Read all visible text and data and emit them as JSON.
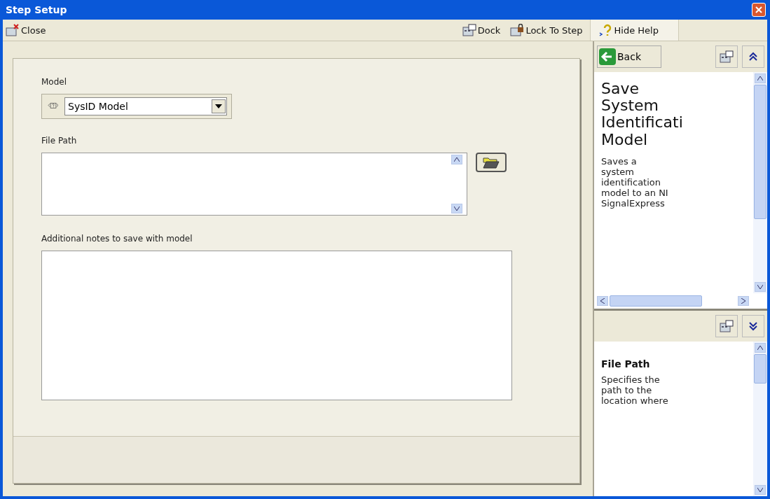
{
  "window": {
    "title": "Step Setup"
  },
  "toolbar": {
    "left": [
      {
        "label": "Close",
        "kind": "close"
      }
    ],
    "right": [
      {
        "label": "Dock",
        "kind": "dock"
      },
      {
        "label": "Lock To Step",
        "kind": "lock"
      },
      {
        "label": "Hide Help",
        "kind": "help"
      }
    ]
  },
  "form": {
    "model": {
      "label": "Model",
      "value": "SysID Model"
    },
    "file_path": {
      "label": "File Path"
    },
    "notes": {
      "label": "Additional notes to save with model"
    }
  },
  "help": {
    "back": "Back",
    "top": {
      "title_lines": [
        "Save",
        "System",
        "Identificati",
        "Model"
      ],
      "body_lines": [
        "Saves a",
        "system",
        "identification",
        "model to an NI",
        "SignalExpress"
      ]
    },
    "bottom": {
      "title": "File Path",
      "body_lines": [
        "Specifies the",
        "path to the",
        "location where"
      ]
    }
  }
}
